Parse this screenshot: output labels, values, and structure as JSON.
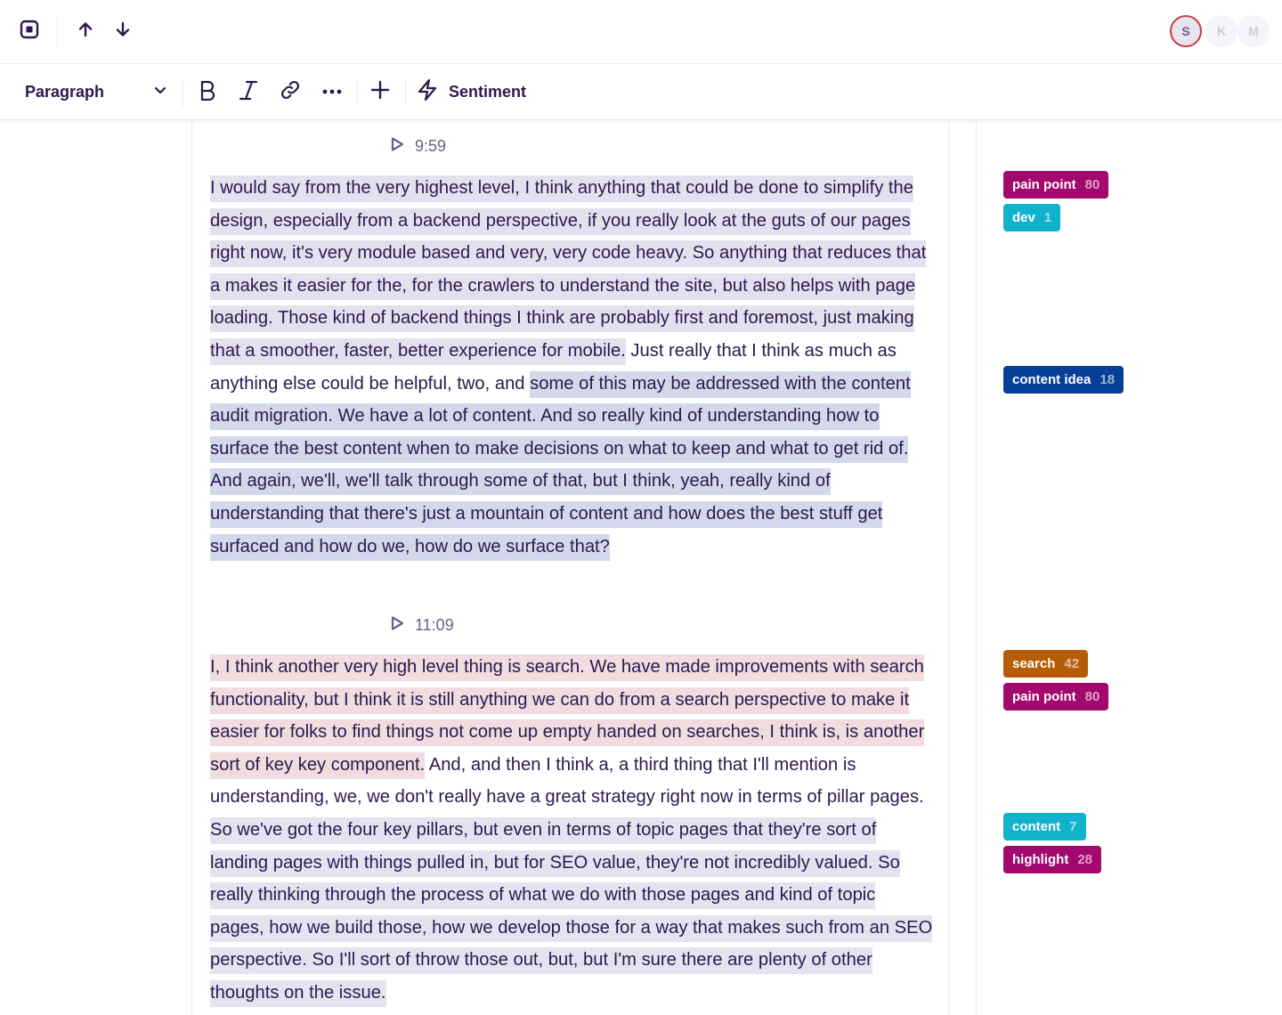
{
  "topbar": {
    "icons": [
      "stop-square-icon",
      "arrow-up-icon",
      "arrow-down-icon"
    ],
    "collaborators": [
      {
        "initial": "S",
        "active": true,
        "ring_color": "#d23a3a"
      },
      {
        "initial": "K",
        "active": false
      },
      {
        "initial": "M",
        "active": false
      }
    ]
  },
  "toolbar": {
    "block_type": "Paragraph",
    "buttons": [
      "bold",
      "italic",
      "link",
      "more",
      "add",
      "sentiment"
    ],
    "sentiment_label": "Sentiment"
  },
  "transcript": [
    {
      "timestamp": "9:59",
      "segments": [
        {
          "style": "purple",
          "text": "I would say from the very highest level, I think anything that could be done to simplify the design, especially from a backend perspective, if you really look at the guts of our pages right now, it's very module based and very, very code heavy. So anything that reduces that a makes it easier for the, for the crawlers to understand the site, but also helps with page loading. Those kind of backend things I think are probably first and foremost, just making that a smoother, faster, better experience for mobile."
        },
        {
          "style": "none",
          "text": " Just really that I think as much as anything else could be helpful, two, and "
        },
        {
          "style": "blue",
          "text": "some of this may be addressed with the content audit migration. We have a lot of content. And so really kind of understanding how to surface the best content when to make decisions on what to keep and what to get rid of. And again, we'll, we'll talk through some of that, but I think, yeah, really kind of understanding that there's just a mountain of content and how does the best stuff get surfaced and how do we, how do we surface that?"
        }
      ]
    },
    {
      "timestamp": "11:09",
      "segments": [
        {
          "style": "pink",
          "text": "I, I think another very high level thing is search. We have made improvements with search functionality, but I think it is still anything we can do from a search perspective to make it easier for folks to find things not come up empty handed on searches, I think is, is another sort of key key component."
        },
        {
          "style": "none",
          "text": " And, and then I think a, a third thing that I'll mention is understanding, we, we don't really have a great strategy right now in terms of pillar pages. "
        },
        {
          "style": "lav",
          "text": "So we've got the four key pillars, but even in terms of topic pages that they're sort of landing pages with things pulled in, but for SEO value, they're not incredibly valued. So really thinking through the process of what we do with those pages and kind of topic pages, how we build those, how we develop those for a way that makes such from an SEO perspective. So I'll sort of throw those out, but, but I'm sure there are plenty of other thoughts on the issue."
        }
      ]
    }
  ],
  "tags": [
    {
      "label": "pain point",
      "count": "80",
      "color": "#a3086e"
    },
    {
      "label": "dev",
      "count": "1",
      "color": "#11b3cc"
    },
    {
      "label": "content idea",
      "count": "18",
      "color": "#063f98"
    },
    {
      "label": "search",
      "count": "42",
      "color": "#b65c06"
    },
    {
      "label": "pain point",
      "count": "80",
      "color": "#a3086e"
    },
    {
      "label": "content",
      "count": "7",
      "color": "#11b3cc"
    },
    {
      "label": "highlight",
      "count": "28",
      "color": "#a3086e"
    }
  ]
}
